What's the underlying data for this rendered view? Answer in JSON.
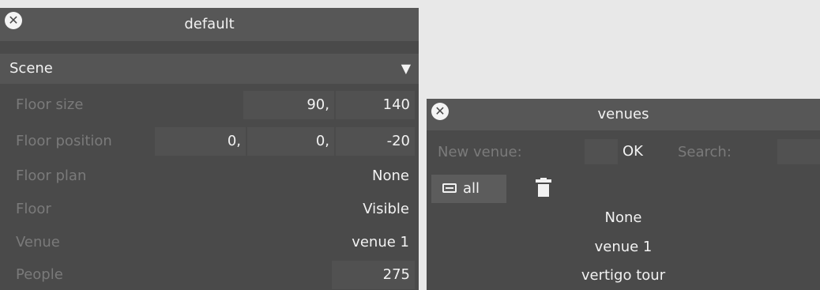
{
  "default_panel": {
    "title": "default",
    "close_glyph": "✕",
    "section": {
      "label": "Scene",
      "arrow": "▼"
    },
    "props": {
      "floor_size": {
        "label": "Floor size",
        "x": "90",
        "sep": ",",
        "y": "140"
      },
      "floor_position": {
        "label": "Floor position",
        "x": "0",
        "y": "0",
        "z": "-20",
        "sep": ","
      },
      "floor_plan": {
        "label": "Floor plan",
        "value": "None"
      },
      "floor": {
        "label": "Floor",
        "value": "Visible"
      },
      "venue": {
        "label": "Venue",
        "value": "venue 1"
      },
      "people": {
        "label": "People",
        "value": "275"
      }
    }
  },
  "venues_panel": {
    "title": "venues",
    "close_glyph": "✕",
    "new_venue_label": "New venue:",
    "new_venue_value": "",
    "ok_label": "OK",
    "search_label": "Search:",
    "search_value": "",
    "all_label": "all",
    "icons": {
      "all": "list-icon",
      "delete": "trash-icon",
      "close": "close-icon"
    },
    "venues": [
      "None",
      "venue 1",
      "vertigo tour"
    ]
  },
  "colors": {
    "background": "#e8e8e8",
    "panel": "#4a4a4a",
    "titlebar": "#575757",
    "label": "#7a7a7a",
    "value": "#f2f2f2"
  }
}
